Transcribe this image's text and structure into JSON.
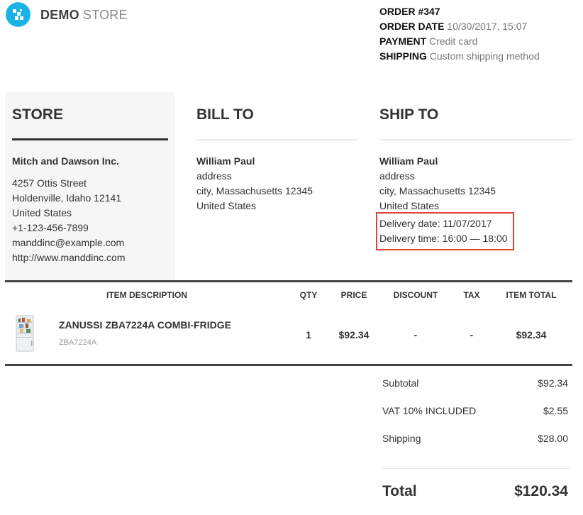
{
  "logo": {
    "brand_bold": "DEMO",
    "brand_light": "STORE",
    "color": "#1ab3e6"
  },
  "order": {
    "number_label": "ORDER #347",
    "date_label": "ORDER DATE",
    "date_value": "10/30/2017, 15:07",
    "payment_label": "PAYMENT",
    "payment_value": "Credit card",
    "shipping_label": "SHIPPING",
    "shipping_value": "Custom shipping method"
  },
  "store": {
    "title": "STORE",
    "name": "Mitch and Dawson Inc.",
    "lines": [
      "4257 Ottis Street",
      "Holdenville, Idaho 12141",
      "United States",
      "+1-123-456-7899",
      "manddinc@example.com",
      "http://www.manddinc.com"
    ]
  },
  "bill_to": {
    "title": "BILL TO",
    "name": "William Paul",
    "lines": [
      "address",
      "city, Massachusetts 12345",
      "United States"
    ]
  },
  "ship_to": {
    "title": "SHIP TO",
    "name": "William Paul",
    "lines": [
      "address",
      "city, Massachusetts 12345",
      "United States"
    ],
    "delivery_date": "Delivery date: 11/07/2017",
    "delivery_time": "Delivery time: 16:00 — 18:00",
    "highlight_color": "#e3403a"
  },
  "items": {
    "headers": {
      "description": "ITEM DESCRIPTION",
      "qty": "QTY",
      "price": "PRICE",
      "discount": "DISCOUNT",
      "tax": "TAX",
      "total": "ITEM TOTAL"
    },
    "rows": [
      {
        "name": "ZANUSSI ZBA7224A COMBI-FRIDGE",
        "sku": "ZBA7224A",
        "qty": "1",
        "price": "$92.34",
        "discount": "-",
        "tax": "-",
        "total": "$92.34"
      }
    ]
  },
  "totals": {
    "subtotal_label": "Subtotal",
    "subtotal_value": "$92.34",
    "vat_label": "VAT 10% INCLUDED",
    "vat_value": "$2.55",
    "shipping_label": "Shipping",
    "shipping_value": "$28.00",
    "total_label": "Total",
    "total_value": "$120.34"
  }
}
